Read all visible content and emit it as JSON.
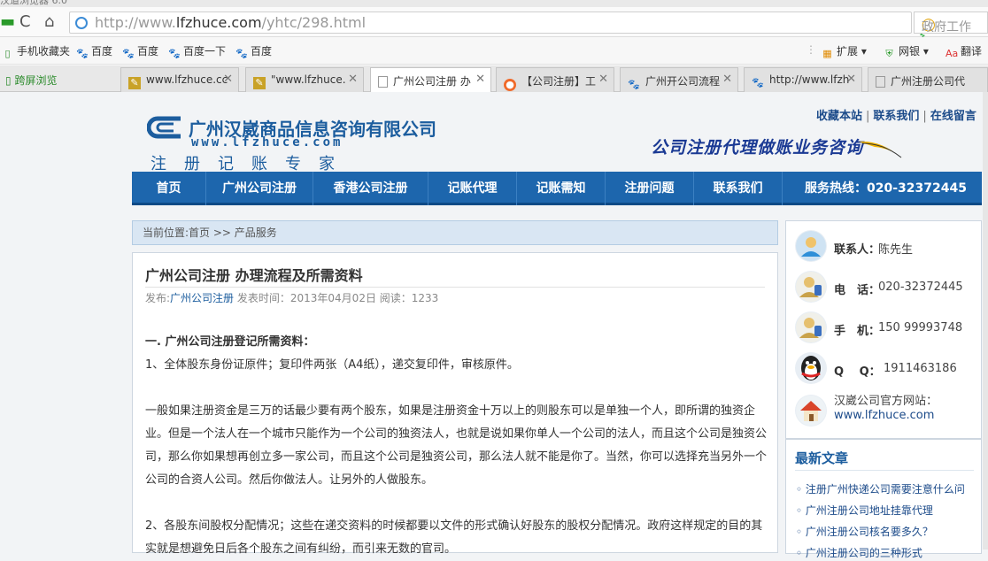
{
  "browser": {
    "title_fragment": "汉道浏览器 6.0",
    "nav": {
      "back": "←",
      "refresh": "C",
      "home": "⌂"
    },
    "address": {
      "prefix": "http://www.",
      "domain": "lfzhuce.com",
      "path": "/yhtc/298.html"
    },
    "search_placeholder": "政府工作",
    "bookmarks": [
      {
        "label": "手机收藏夹",
        "icon": "phone-icon"
      },
      {
        "label": "百度",
        "icon": "baidu-paw-icon"
      },
      {
        "label": "百度",
        "icon": "baidu-paw-icon"
      },
      {
        "label": "百度一下",
        "icon": "baidu-paw-icon"
      },
      {
        "label": "百度",
        "icon": "baidu-paw-icon"
      }
    ],
    "bookmarks_right": [
      {
        "label": "扩展",
        "icon": "extensions-icon"
      },
      {
        "label": "网银",
        "icon": "bank-shield-icon"
      },
      {
        "label": "翻译",
        "icon": "translate-icon"
      }
    ],
    "cross_screen_label": "跨屏浏览",
    "tabs": [
      {
        "label": "www.lfzhuce.cc",
        "icon": "site-icon",
        "active": false
      },
      {
        "label": "\"www.lfzhuce.",
        "icon": "site-icon",
        "active": false
      },
      {
        "label": "广州公司注册 办",
        "icon": "page-icon",
        "active": true
      },
      {
        "label": "【公司注册】工",
        "icon": "orange-site-icon",
        "active": false
      },
      {
        "label": "广州开公司流程",
        "icon": "baidu-paw-icon",
        "active": false
      },
      {
        "label": "http://www.lfzh",
        "icon": "baidu-paw-icon",
        "active": false
      },
      {
        "label": "广州注册公司代",
        "icon": "page-icon",
        "active": false
      }
    ]
  },
  "site": {
    "company_name": "广州汉崴商品信息咨询有限公司",
    "company_url": "www.lfzhuce.com",
    "slogan": "注册记账专家",
    "top_links": [
      "收藏本站",
      "联系我们",
      "在线留言"
    ],
    "business_slogan": "公司注册代理做账业务咨询",
    "nav": [
      "首页",
      "广州公司注册",
      "香港公司注册",
      "记账代理",
      "记账需知",
      "注册问题",
      "联系我们"
    ],
    "hotline": "服务热线：020-32372445",
    "breadcrumb": "当前位置:首页 >> 产品服务"
  },
  "article": {
    "title": "广州公司注册 办理流程及所需资料",
    "meta_prefix": "发布:",
    "meta_category": "广州公司注册",
    "meta_rest": " 发表时间：2013年04月02日 阅读：1233",
    "heading1": "一. 广州公司注册登记所需资料：",
    "item1": "1、全体股东身份证原件；复印件两张（A4纸），递交复印件，审核原件。",
    "para2": "一般如果注册资金是三万的话最少要有两个股东，如果是注册资金十万以上的则股东可以是单独一个人，即所谓的独资企业。但是一个法人在一个城市只能作为一个公司的独资法人，也就是说如果你单人一个公司的法人，而且这个公司是独资公司，那么你如果想再创立多一家公司，而且这个公司是独资公司，那么法人就不能是你了。当然，你可以选择充当另外一个公司的合资人公司。然后你做法人。让另外的人做股东。",
    "para3": "2、各股东间股权分配情况；这些在递交资料的时候都要以文件的形式确认好股东的股权分配情况。政府这样规定的目的其实就是想避免日后各个股东之间有纠纷，而引来无数的官司。"
  },
  "contact": {
    "person_label": "联系人：",
    "person_value": "陈先生",
    "phone_label": "电　话：",
    "phone_value": "020-32372445",
    "mobile_label": "手　机：",
    "mobile_value": "150 99993748",
    "qq_label": "Q　 Q：",
    "qq_value": "1911463186",
    "site_label": "汉崴公司官方网站：",
    "site_value": "www.lfzhuce.com"
  },
  "news": {
    "title": "最新文章",
    "items": [
      "注册广州快递公司需要注意什么问",
      "广州注册公司地址挂靠代理",
      "广州注册公司核名要多久？",
      "广州注册公司的三种形式"
    ]
  },
  "colors": {
    "brand_blue": "#1d66ad",
    "link_blue": "#1c4b8a"
  }
}
